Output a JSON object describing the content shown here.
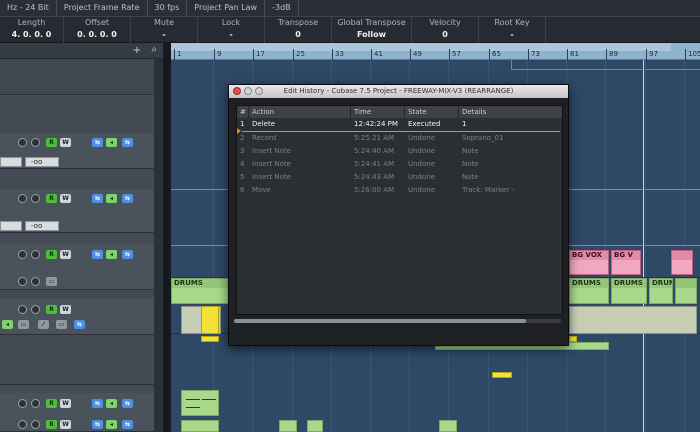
{
  "statusbar": [
    "Hz - 24 Bit",
    "Project Frame Rate",
    "30 fps",
    "Project Pan Law",
    "-3dB"
  ],
  "infoline": [
    {
      "label": "Length",
      "value": "4. 0. 0.   0"
    },
    {
      "label": "Offset",
      "value": "0. 0. 0.   0"
    },
    {
      "label": "Mute",
      "value": "-"
    },
    {
      "label": "Lock",
      "value": "-"
    },
    {
      "label": "Transpose",
      "value": "0"
    },
    {
      "label": "Global Transpose",
      "value": "Follow"
    },
    {
      "label": "Velocity",
      "value": "0"
    },
    {
      "label": "Root Key",
      "value": "-"
    }
  ],
  "tracklist": {
    "add_icon": "+",
    "search_icon": "⌕",
    "field_value": "-oo"
  },
  "ruler": {
    "ticks": [
      "1",
      "9",
      "17",
      "25",
      "33",
      "41",
      "49",
      "57",
      "65",
      "73",
      "81",
      "89",
      "97",
      "105"
    ]
  },
  "parts": {
    "drums": "DRUMS",
    "bgvox": "BG VOX",
    "bgv": "BG V"
  },
  "dialog": {
    "title": "Edit History - Cubase 7.5 Project - FREEWAY-MIX-V3 (REARRANGE)",
    "columns": [
      "#",
      "Action",
      "Time",
      "State",
      "Details"
    ],
    "rows": [
      {
        "n": "1",
        "action": "Delete",
        "time": "12:42:24 PM",
        "state": "Executed",
        "details": "1"
      },
      {
        "n": "2",
        "action": "Record",
        "time": "5:25:21 AM",
        "state": "Undone",
        "details": "Soprano_01"
      },
      {
        "n": "3",
        "action": "Insert Note",
        "time": "5:24:40 AM",
        "state": "Undone",
        "details": "Note"
      },
      {
        "n": "4",
        "action": "Insert Note",
        "time": "5:24:41 AM",
        "state": "Undone",
        "details": "Note"
      },
      {
        "n": "5",
        "action": "Insert Note",
        "time": "5:24:43 AM",
        "state": "Undone",
        "details": "Note"
      },
      {
        "n": "6",
        "action": "Move",
        "time": "5:26:00 AM",
        "state": "Undone",
        "details": "Track: Marker -"
      }
    ]
  }
}
